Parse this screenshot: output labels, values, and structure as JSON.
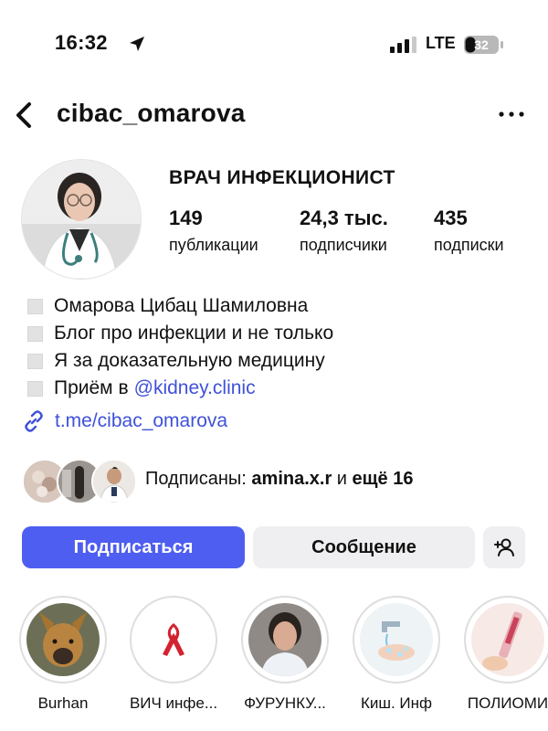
{
  "status_bar": {
    "time": "16:32",
    "network": "LTE",
    "battery": "32"
  },
  "header": {
    "username": "cibac_omarova"
  },
  "profile": {
    "title": "ВРАЧ ИНФЕКЦИОНИСТ",
    "stats": [
      {
        "value": "149",
        "label": "публикации"
      },
      {
        "value": "24,3 тыс.",
        "label": "подписчики"
      },
      {
        "value": "435",
        "label": "подписки"
      }
    ],
    "bio": {
      "line1": "Омарова Цибац Шамиловна",
      "line2": "Блог про инфекции и не только",
      "line3": "Я за доказательную медицину",
      "line4_prefix": "Приём в",
      "line4_mention": "@kidney.clinic"
    },
    "link": "t.me/cibac_omarova"
  },
  "followed_by": {
    "prefix": "Подписаны:",
    "user": "amina.x.r",
    "conj": "и",
    "more": "ещё 16"
  },
  "buttons": {
    "follow": "Подписаться",
    "message": "Сообщение"
  },
  "highlights": [
    {
      "label": "Burhan"
    },
    {
      "label": "ВИЧ инфе..."
    },
    {
      "label": "ФУРУНКУ..."
    },
    {
      "label": "Киш. Инф"
    },
    {
      "label": "ПОЛИОМИ"
    }
  ],
  "colors": {
    "accent": "#4e5ef0",
    "link": "#3f51d8",
    "secondary_button": "#efeff1"
  }
}
